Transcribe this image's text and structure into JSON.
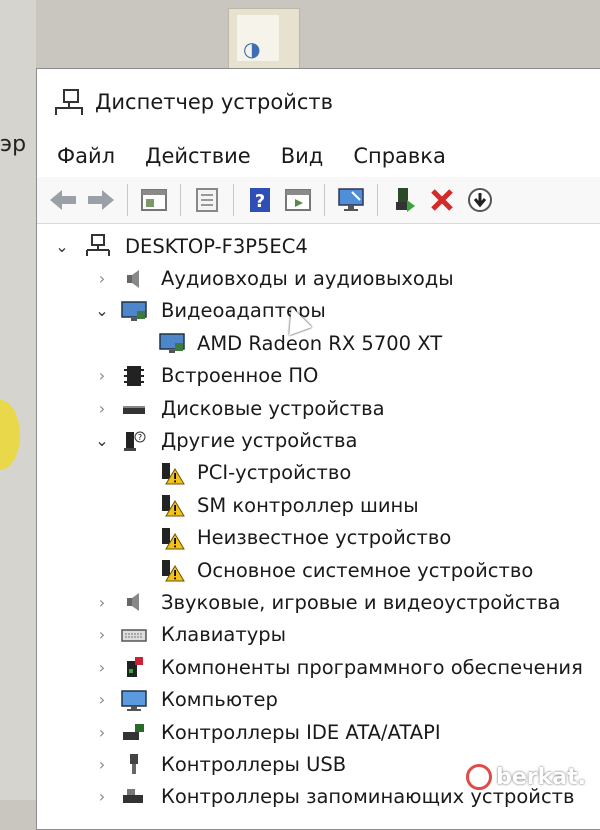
{
  "window": {
    "title": "Диспетчер устройств"
  },
  "menu": [
    "Файл",
    "Действие",
    "Вид",
    "Справка"
  ],
  "toolbar": {
    "buttons": [
      "back-icon",
      "forward-icon",
      "properties-icon",
      "update-driver-icon",
      "help-icon",
      "view-icon",
      "monitor-icon",
      "enable-device-icon",
      "uninstall-icon",
      "download-icon"
    ]
  },
  "tree": {
    "root": "DESKTOP-F3P5EC4",
    "items": [
      {
        "label": "Аудиовходы и аудиовыходы",
        "icon": "speaker-icon",
        "expanded": false
      },
      {
        "label": "Видеоадаптеры",
        "icon": "display-adapter-icon",
        "expanded": true,
        "children": [
          {
            "label": "AMD Radeon RX 5700 XT",
            "icon": "display-adapter-icon"
          }
        ]
      },
      {
        "label": "Встроенное ПО",
        "icon": "firmware-icon",
        "expanded": false
      },
      {
        "label": "Дисковые устройства",
        "icon": "disk-icon",
        "expanded": false
      },
      {
        "label": "Другие устройства",
        "icon": "unknown-device-icon",
        "expanded": true,
        "children": [
          {
            "label": "PCI-устройство",
            "icon": "warning-device-icon"
          },
          {
            "label": "SM контроллер шины",
            "icon": "warning-device-icon"
          },
          {
            "label": "Неизвестное устройство",
            "icon": "warning-device-icon"
          },
          {
            "label": "Основное системное устройство",
            "icon": "warning-device-icon"
          }
        ]
      },
      {
        "label": "Звуковые, игровые и видеоустройства",
        "icon": "speaker-icon",
        "expanded": false
      },
      {
        "label": "Клавиатуры",
        "icon": "keyboard-icon",
        "expanded": false
      },
      {
        "label": "Компоненты программного обеспечения",
        "icon": "software-component-icon",
        "expanded": false
      },
      {
        "label": "Компьютер",
        "icon": "computer-icon",
        "expanded": false
      },
      {
        "label": "Контроллеры IDE ATA/ATAPI",
        "icon": "ide-controller-icon",
        "expanded": false
      },
      {
        "label": "Контроллеры USB",
        "icon": "usb-icon",
        "expanded": false
      },
      {
        "label": "Контроллеры запоминающих устройств",
        "icon": "storage-controller-icon",
        "expanded": false
      }
    ]
  },
  "watermark": {
    "text": "berkat."
  },
  "desktop": {
    "fragment": "эр"
  }
}
